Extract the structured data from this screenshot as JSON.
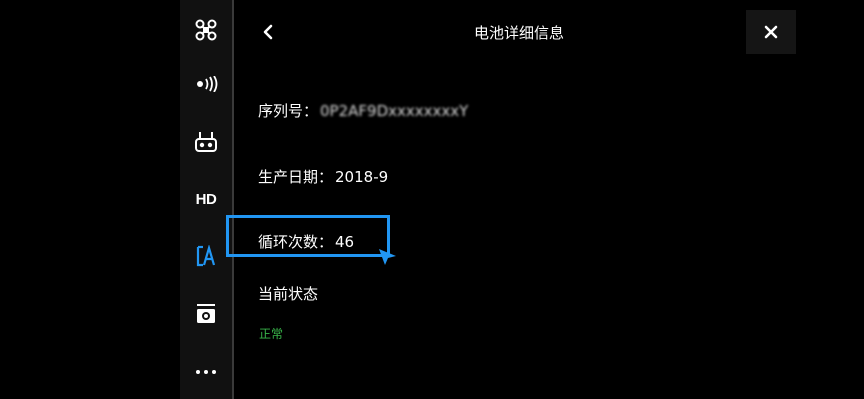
{
  "sidebar": {
    "items": [
      {
        "icon": "aircraft-icon"
      },
      {
        "icon": "signal-icon"
      },
      {
        "icon": "remote-controller-icon"
      },
      {
        "label": "HD"
      },
      {
        "icon": "battery-icon"
      },
      {
        "icon": "camera-icon"
      },
      {
        "icon": "more-icon"
      }
    ]
  },
  "header": {
    "title": "电池详细信息",
    "back_icon": "chevron-left-icon",
    "close_icon": "close-icon"
  },
  "details": {
    "serial_label": "序列号：",
    "serial_value": "0P2AF9DxxxxxxxxY",
    "production_label": "生产日期：",
    "production_value": "2018-9",
    "cycles_label": "循环次数：",
    "cycles_value": "46",
    "status_label": "当前状态",
    "status_value": "正常"
  },
  "colors": {
    "highlight": "#2196f3",
    "status_ok": "#39b54a",
    "sidebar_active": "#2196f3"
  }
}
